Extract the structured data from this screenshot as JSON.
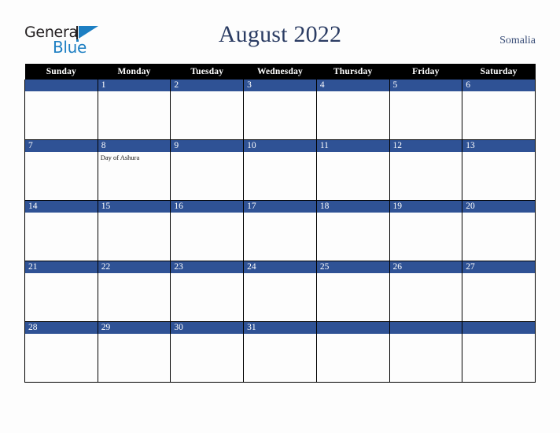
{
  "brand": {
    "name_part1": "General",
    "name_part2": "Blue",
    "mark": "triangle-mark"
  },
  "header": {
    "title": "August 2022",
    "country": "Somalia"
  },
  "colors": {
    "date_bar_blue": "#2f5295",
    "header_black": "#000000",
    "title_navy": "#2b3c63",
    "country_navy": "#3a4e78",
    "logo_blue": "#1d7fc3",
    "page_background": "#fdfdfd"
  },
  "calendar": {
    "weekday_headers": [
      "Sunday",
      "Monday",
      "Tuesday",
      "Wednesday",
      "Thursday",
      "Friday",
      "Saturday"
    ],
    "weeks": [
      [
        {
          "date": "",
          "events": []
        },
        {
          "date": "1",
          "events": []
        },
        {
          "date": "2",
          "events": []
        },
        {
          "date": "3",
          "events": []
        },
        {
          "date": "4",
          "events": []
        },
        {
          "date": "5",
          "events": []
        },
        {
          "date": "6",
          "events": []
        }
      ],
      [
        {
          "date": "7",
          "events": []
        },
        {
          "date": "8",
          "events": [
            "Day of Ashura"
          ]
        },
        {
          "date": "9",
          "events": []
        },
        {
          "date": "10",
          "events": []
        },
        {
          "date": "11",
          "events": []
        },
        {
          "date": "12",
          "events": []
        },
        {
          "date": "13",
          "events": []
        }
      ],
      [
        {
          "date": "14",
          "events": []
        },
        {
          "date": "15",
          "events": []
        },
        {
          "date": "16",
          "events": []
        },
        {
          "date": "17",
          "events": []
        },
        {
          "date": "18",
          "events": []
        },
        {
          "date": "19",
          "events": []
        },
        {
          "date": "20",
          "events": []
        }
      ],
      [
        {
          "date": "21",
          "events": []
        },
        {
          "date": "22",
          "events": []
        },
        {
          "date": "23",
          "events": []
        },
        {
          "date": "24",
          "events": []
        },
        {
          "date": "25",
          "events": []
        },
        {
          "date": "26",
          "events": []
        },
        {
          "date": "27",
          "events": []
        }
      ],
      [
        {
          "date": "28",
          "events": []
        },
        {
          "date": "29",
          "events": []
        },
        {
          "date": "30",
          "events": []
        },
        {
          "date": "31",
          "events": []
        },
        {
          "date": "",
          "events": []
        },
        {
          "date": "",
          "events": []
        },
        {
          "date": "",
          "events": []
        }
      ]
    ]
  }
}
